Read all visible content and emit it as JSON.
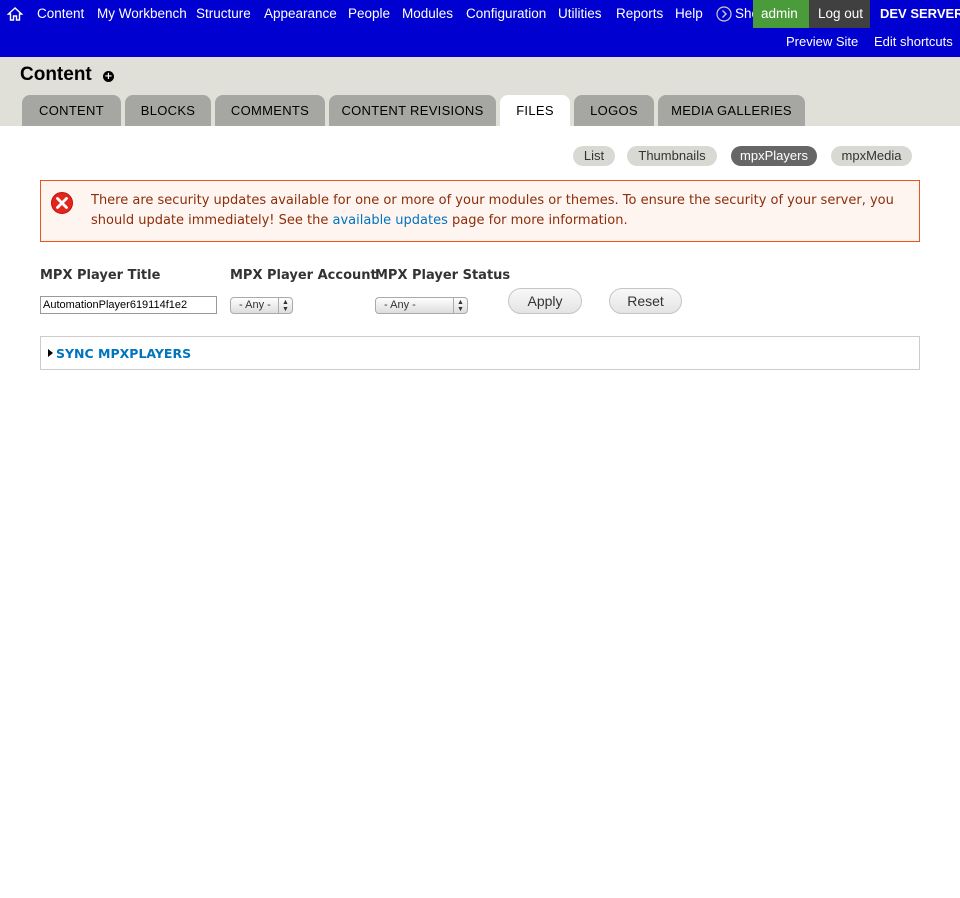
{
  "toolbar": {
    "menu": [
      "Content",
      "My Workbench",
      "Structure",
      "Appearance",
      "People",
      "Modules",
      "Configuration",
      "Utilities",
      "Reports",
      "Help"
    ],
    "shortcuts_label": "Shortcuts",
    "user_label": "admin",
    "logout_label": "Log out",
    "env_label": "DEV SERVER",
    "shortcut_links": [
      "Preview Site",
      "Edit shortcuts"
    ],
    "colors": {
      "bar": "#0000d0",
      "user": "#4a9b3a",
      "logout": "#404040"
    }
  },
  "page": {
    "title": "Content",
    "tabs": [
      "Content",
      "Blocks",
      "Comments",
      "Content Revisions",
      "Files",
      "Logos",
      "Media Galleries"
    ],
    "active_tab": "Files",
    "secondary_tabs": [
      "List",
      "Thumbnails",
      "mpxPlayers",
      "mpxMedia"
    ],
    "active_secondary_tab": "mpxPlayers"
  },
  "message": {
    "text_before": "There are security updates available for one or more of your modules or themes. To ensure the security of your server, you should update immediately! See the ",
    "link": "available updates",
    "text_after": " page for more information."
  },
  "filters": {
    "title_label": "MPX Player Title",
    "title_value": "AutomationPlayer619114f1e2",
    "account_label": "MPX Player Account",
    "account_value": "- Any -",
    "status_label": "MPX Player Status",
    "status_value": "- Any -",
    "apply": "Apply",
    "reset": "Reset"
  },
  "fieldset": {
    "legend": "Sync mpxPlayers"
  }
}
